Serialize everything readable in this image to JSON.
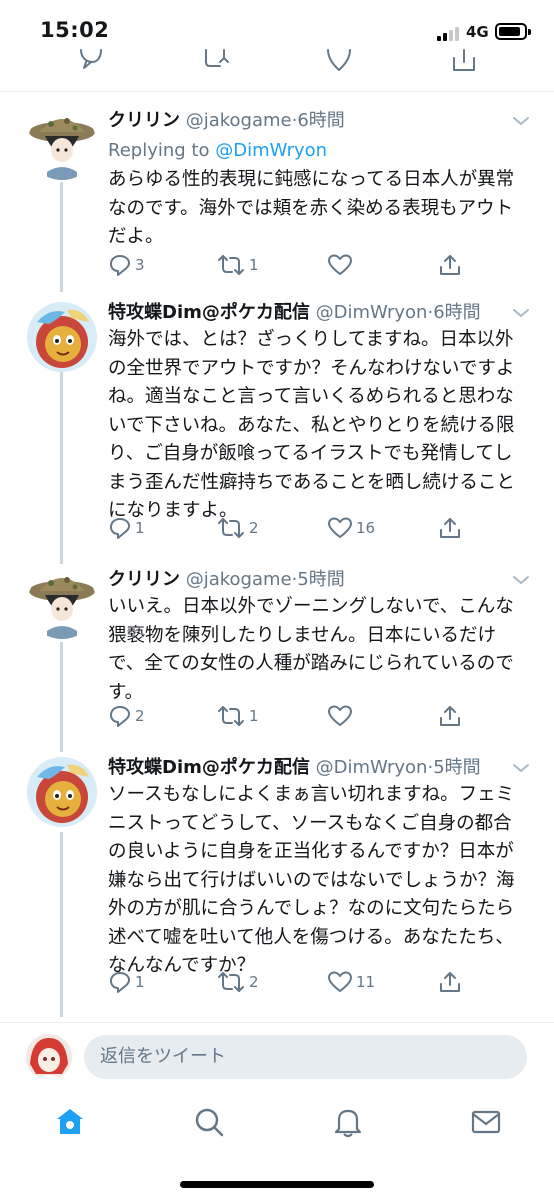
{
  "status_bar": {
    "time": "15:02",
    "network": "4G"
  },
  "tweets": [
    {
      "name": "クリリン",
      "handle": "@jakogame",
      "time": "6時間",
      "replying_label": "Replying to",
      "replying_handle": "@DimWryon",
      "text": "あらゆる性的表現に鈍感になってる日本人が異常なのです。海外では頬を赤く染める表現もアウトだよ。",
      "replies": "3",
      "retweets": "1",
      "likes": "",
      "avatar": "hat-avatar"
    },
    {
      "name": "特攻蝶Dim@ポケカ配信",
      "handle": "@DimWryon",
      "time": "6時間",
      "text": "海外では、とは？ざっくりしてますね。日本以外の全世界でアウトですか？そんなわけないですよね。適当なこと言って言いくるめられると思わないで下さいね。あなた、私とやりとりを続ける限り、ご自身が飯喰ってるイラストでも発情してしまう歪んだ性癖持ちであることを晒し続けることになりますよ。",
      "replies": "1",
      "retweets": "2",
      "likes": "16",
      "avatar": "lion-avatar"
    },
    {
      "name": "クリリン",
      "handle": "@jakogame",
      "time": "5時間",
      "text": "いいえ。日本以外でゾーニングしないで、こんな猥褻物を陳列したりしません。日本にいるだけで、全ての女性の人種が踏みにじられているのです。",
      "replies": "2",
      "retweets": "1",
      "likes": "",
      "avatar": "hat-avatar"
    },
    {
      "name": "特攻蝶Dim@ポケカ配信",
      "handle": "@DimWryon",
      "time": "5時間",
      "text": "ソースもなしによくまぁ言い切れますね。フェミニストってどうして、ソースもなくご自身の都合の良いように自身を正当化するんですか？日本が嫌なら出て行けばいいのではないでしょうか？海外の方が肌に合うんでしょ？なのに文句たらたら述べて嘘を吐いて他人を傷つける。あなたたち、なんなんですか？",
      "replies": "1",
      "retweets": "2",
      "likes": "11",
      "avatar": "lion-avatar"
    }
  ],
  "reply_bar": {
    "placeholder": "返信をツイート"
  },
  "tab_bar": {
    "active": "home",
    "items": [
      "home-icon",
      "search-icon",
      "notifications-icon",
      "messages-icon"
    ]
  },
  "colors": {
    "accent": "#1da1f2",
    "muted": "#657786",
    "divider": "#e6ecf0"
  }
}
